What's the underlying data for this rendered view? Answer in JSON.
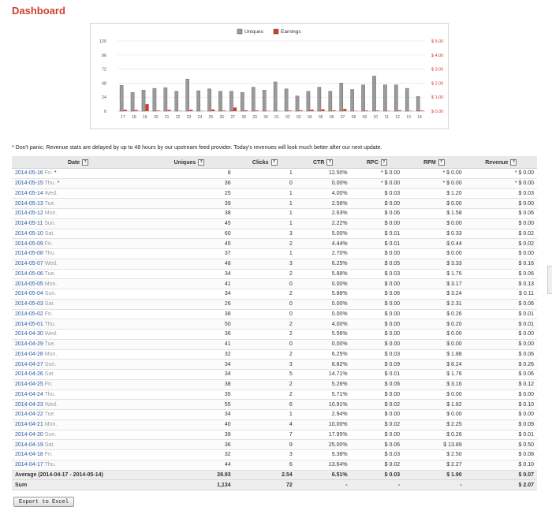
{
  "page": {
    "title": "Dashboard"
  },
  "note": "* Don't panic: Revenue stats are delayed by up to 48 hours by our upstream feed provider. Today's revenues will look much better after our next update.",
  "chart_data": {
    "type": "bar",
    "categories": [
      "17",
      "18",
      "19",
      "20",
      "21",
      "22",
      "23",
      "24",
      "25",
      "26",
      "27",
      "28",
      "29",
      "30",
      "01",
      "02",
      "03",
      "04",
      "05",
      "06",
      "07",
      "08",
      "09",
      "10",
      "11",
      "12",
      "13",
      "14"
    ],
    "series": [
      {
        "name": "Uniques",
        "axis": "left",
        "color": "#9b9b9b",
        "values": [
          44,
          32,
          36,
          39,
          40,
          34,
          55,
          35,
          38,
          34,
          34,
          32,
          41,
          36,
          50,
          38,
          26,
          34,
          41,
          34,
          48,
          37,
          45,
          60,
          45,
          45,
          39,
          25
        ]
      },
      {
        "name": "Earnings",
        "axis": "right",
        "color": "#d63a2a",
        "values": [
          0.1,
          0.08,
          0.5,
          0.01,
          0.09,
          0.0,
          0.1,
          0.0,
          0.12,
          0.01,
          0.26,
          0.06,
          0.05,
          0.0,
          0.0,
          0.01,
          0.06,
          0.11,
          0.13,
          0.06,
          0.16,
          0.0,
          0.02,
          0.02,
          0.0,
          0.06,
          0.0,
          0.03
        ]
      }
    ],
    "left_ticks": [
      "0",
      "24",
      "48",
      "72",
      "96",
      "120"
    ],
    "right_ticks": [
      "$ 0.00",
      "$ 1.00",
      "$ 2.00",
      "$ 3.00",
      "$ 4.00",
      "$ 5.00"
    ],
    "left_ylim": [
      0,
      120
    ],
    "right_ylim": [
      0,
      5
    ],
    "grid": true,
    "legend": "top-center"
  },
  "table": {
    "columns": [
      "Date",
      "Uniques",
      "Clicks",
      "CTR",
      "RPC",
      "RPM",
      "Revenue"
    ],
    "help_glyph": "?",
    "rows": [
      {
        "date": "2014-05-16",
        "dow": "Fri.",
        "star": "*",
        "uniques": "8",
        "clicks": "1",
        "ctr": "12.50%",
        "rpc": "* $ 0.00",
        "rpm": "* $ 0.00",
        "revenue": "* $ 0.00"
      },
      {
        "date": "2014-05-15",
        "dow": "Thu.",
        "star": "*",
        "uniques": "36",
        "clicks": "0",
        "ctr": "0.00%",
        "rpc": "* $ 0.00",
        "rpm": "* $ 0.00",
        "revenue": "* $ 0.00"
      },
      {
        "date": "2014-05-14",
        "dow": "Wed.",
        "star": "",
        "uniques": "25",
        "clicks": "1",
        "ctr": "4.00%",
        "rpc": "$ 0.03",
        "rpm": "$ 1.20",
        "revenue": "$ 0.03"
      },
      {
        "date": "2014-05-13",
        "dow": "Tue.",
        "star": "",
        "uniques": "39",
        "clicks": "1",
        "ctr": "2.56%",
        "rpc": "$ 0.00",
        "rpm": "$ 0.00",
        "revenue": "$ 0.00"
      },
      {
        "date": "2014-05-12",
        "dow": "Mon.",
        "star": "",
        "uniques": "38",
        "clicks": "1",
        "ctr": "2.63%",
        "rpc": "$ 0.06",
        "rpm": "$ 1.58",
        "revenue": "$ 0.06"
      },
      {
        "date": "2014-05-11",
        "dow": "Sun.",
        "star": "",
        "uniques": "45",
        "clicks": "1",
        "ctr": "2.22%",
        "rpc": "$ 0.00",
        "rpm": "$ 0.00",
        "revenue": "$ 0.00"
      },
      {
        "date": "2014-05-10",
        "dow": "Sat.",
        "star": "",
        "uniques": "60",
        "clicks": "3",
        "ctr": "5.00%",
        "rpc": "$ 0.01",
        "rpm": "$ 0.33",
        "revenue": "$ 0.02"
      },
      {
        "date": "2014-05-09",
        "dow": "Fri.",
        "star": "",
        "uniques": "45",
        "clicks": "2",
        "ctr": "4.44%",
        "rpc": "$ 0.01",
        "rpm": "$ 0.44",
        "revenue": "$ 0.02"
      },
      {
        "date": "2014-05-08",
        "dow": "Thu.",
        "star": "",
        "uniques": "37",
        "clicks": "1",
        "ctr": "2.70%",
        "rpc": "$ 0.00",
        "rpm": "$ 0.00",
        "revenue": "$ 0.00"
      },
      {
        "date": "2014-05-07",
        "dow": "Wed.",
        "star": "",
        "uniques": "48",
        "clicks": "3",
        "ctr": "6.25%",
        "rpc": "$ 0.05",
        "rpm": "$ 3.33",
        "revenue": "$ 0.16"
      },
      {
        "date": "2014-05-06",
        "dow": "Tue.",
        "star": "",
        "uniques": "34",
        "clicks": "2",
        "ctr": "5.88%",
        "rpc": "$ 0.03",
        "rpm": "$ 1.76",
        "revenue": "$ 0.06"
      },
      {
        "date": "2014-05-05",
        "dow": "Mon.",
        "star": "",
        "uniques": "41",
        "clicks": "0",
        "ctr": "0.00%",
        "rpc": "$ 0.00",
        "rpm": "$ 3.17",
        "revenue": "$ 0.13"
      },
      {
        "date": "2014-05-04",
        "dow": "Sun.",
        "star": "",
        "uniques": "34",
        "clicks": "2",
        "ctr": "5.88%",
        "rpc": "$ 0.06",
        "rpm": "$ 3.24",
        "revenue": "$ 0.11"
      },
      {
        "date": "2014-05-03",
        "dow": "Sat.",
        "star": "",
        "uniques": "26",
        "clicks": "0",
        "ctr": "0.00%",
        "rpc": "$ 0.00",
        "rpm": "$ 2.31",
        "revenue": "$ 0.06"
      },
      {
        "date": "2014-05-02",
        "dow": "Fri.",
        "star": "",
        "uniques": "38",
        "clicks": "0",
        "ctr": "0.00%",
        "rpc": "$ 0.00",
        "rpm": "$ 0.26",
        "revenue": "$ 0.01"
      },
      {
        "date": "2014-05-01",
        "dow": "Thu.",
        "star": "",
        "uniques": "50",
        "clicks": "2",
        "ctr": "4.00%",
        "rpc": "$ 0.00",
        "rpm": "$ 0.20",
        "revenue": "$ 0.01"
      },
      {
        "date": "2014-04-30",
        "dow": "Wed.",
        "star": "",
        "uniques": "36",
        "clicks": "2",
        "ctr": "5.56%",
        "rpc": "$ 0.00",
        "rpm": "$ 0.00",
        "revenue": "$ 0.00"
      },
      {
        "date": "2014-04-29",
        "dow": "Tue.",
        "star": "",
        "uniques": "41",
        "clicks": "0",
        "ctr": "0.00%",
        "rpc": "$ 0.00",
        "rpm": "$ 0.00",
        "revenue": "$ 0.00"
      },
      {
        "date": "2014-04-28",
        "dow": "Mon.",
        "star": "",
        "uniques": "32",
        "clicks": "2",
        "ctr": "6.25%",
        "rpc": "$ 0.03",
        "rpm": "$ 1.88",
        "revenue": "$ 0.06"
      },
      {
        "date": "2014-04-27",
        "dow": "Sun.",
        "star": "",
        "uniques": "34",
        "clicks": "3",
        "ctr": "8.82%",
        "rpc": "$ 0.09",
        "rpm": "$ 8.24",
        "revenue": "$ 0.26"
      },
      {
        "date": "2014-04-26",
        "dow": "Sat.",
        "star": "",
        "uniques": "34",
        "clicks": "5",
        "ctr": "14.71%",
        "rpc": "$ 0.01",
        "rpm": "$ 1.76",
        "revenue": "$ 0.06"
      },
      {
        "date": "2014-04-25",
        "dow": "Fri.",
        "star": "",
        "uniques": "38",
        "clicks": "2",
        "ctr": "5.26%",
        "rpc": "$ 0.06",
        "rpm": "$ 3.16",
        "revenue": "$ 0.12"
      },
      {
        "date": "2014-04-24",
        "dow": "Thu.",
        "star": "",
        "uniques": "35",
        "clicks": "2",
        "ctr": "5.71%",
        "rpc": "$ 0.00",
        "rpm": "$ 0.00",
        "revenue": "$ 0.00"
      },
      {
        "date": "2014-04-23",
        "dow": "Wed.",
        "star": "",
        "uniques": "55",
        "clicks": "6",
        "ctr": "10.91%",
        "rpc": "$ 0.02",
        "rpm": "$ 1.82",
        "revenue": "$ 0.10"
      },
      {
        "date": "2014-04-22",
        "dow": "Tue.",
        "star": "",
        "uniques": "34",
        "clicks": "1",
        "ctr": "2.94%",
        "rpc": "$ 0.00",
        "rpm": "$ 0.00",
        "revenue": "$ 0.00"
      },
      {
        "date": "2014-04-21",
        "dow": "Mon.",
        "star": "",
        "uniques": "40",
        "clicks": "4",
        "ctr": "10.00%",
        "rpc": "$ 0.02",
        "rpm": "$ 2.25",
        "revenue": "$ 0.09"
      },
      {
        "date": "2014-04-20",
        "dow": "Sun.",
        "star": "",
        "uniques": "39",
        "clicks": "7",
        "ctr": "17.95%",
        "rpc": "$ 0.00",
        "rpm": "$ 0.26",
        "revenue": "$ 0.01"
      },
      {
        "date": "2014-04-19",
        "dow": "Sat.",
        "star": "",
        "uniques": "36",
        "clicks": "9",
        "ctr": "25.00%",
        "rpc": "$ 0.06",
        "rpm": "$ 13.89",
        "revenue": "$ 0.50"
      },
      {
        "date": "2014-04-18",
        "dow": "Fri.",
        "star": "",
        "uniques": "32",
        "clicks": "3",
        "ctr": "9.38%",
        "rpc": "$ 0.03",
        "rpm": "$ 2.50",
        "revenue": "$ 0.08"
      },
      {
        "date": "2014-04-17",
        "dow": "Thu.",
        "star": "",
        "uniques": "44",
        "clicks": "6",
        "ctr": "13.64%",
        "rpc": "$ 0.02",
        "rpm": "$ 2.27",
        "revenue": "$ 0.10"
      }
    ],
    "average": {
      "label": "Average (2014-04-17 - 2014-05-14)",
      "uniques": "38.93",
      "clicks": "2.54",
      "ctr": "6.51%",
      "rpc": "$ 0.03",
      "rpm": "$ 1.90",
      "revenue": "$ 0.07"
    },
    "sum": {
      "label": "Sum",
      "uniques": "1,134",
      "clicks": "72",
      "ctr": "-",
      "rpc": "-",
      "rpm": "-",
      "revenue": "$ 2.07"
    }
  },
  "export_label": "Export to Excel"
}
